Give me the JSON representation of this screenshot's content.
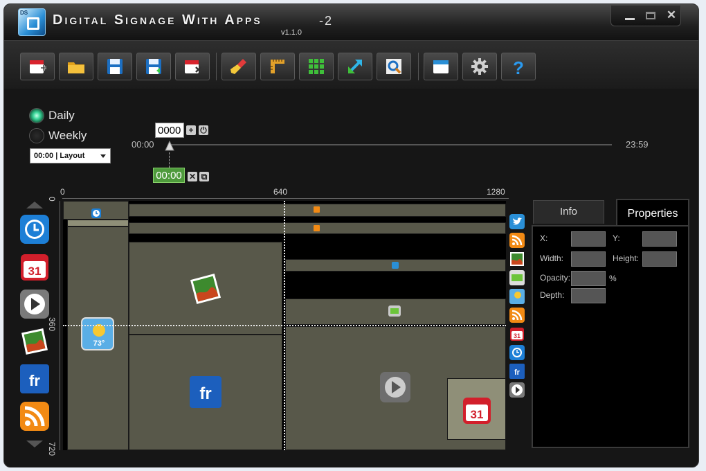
{
  "app": {
    "title": "Digital Signage With Apps",
    "instance": "-2",
    "version": "v1.1.0",
    "logo_text": "DS"
  },
  "window_controls": {
    "minimize": "minimize",
    "maximize": "maximize",
    "close": "✕"
  },
  "toolbar": {
    "buttons": [
      {
        "name": "new-schedule",
        "icon": "calendar-add-icon"
      },
      {
        "name": "open",
        "icon": "folder-icon"
      },
      {
        "name": "save",
        "icon": "floppy-icon"
      },
      {
        "name": "save-as",
        "icon": "floppy-arrow-icon"
      },
      {
        "name": "close-schedule",
        "icon": "calendar-remove-icon"
      },
      {
        "name": "clear",
        "icon": "broom-icon"
      },
      {
        "name": "ruler",
        "icon": "ruler-icon"
      },
      {
        "name": "grid",
        "icon": "grid-icon"
      },
      {
        "name": "resize",
        "icon": "arrows-icon"
      },
      {
        "name": "preview",
        "icon": "magnifier-icon"
      },
      {
        "name": "window",
        "icon": "window-icon"
      },
      {
        "name": "settings",
        "icon": "gear-icon"
      },
      {
        "name": "help",
        "icon": "help-icon"
      }
    ]
  },
  "schedule": {
    "daily_label": "Daily",
    "weekly_label": "Weekly",
    "selected": "Daily",
    "layout_select": "00:00 | Layout",
    "time_input": "0000",
    "current_time": "00:00",
    "start_time": "00:00",
    "end_time": "23:59"
  },
  "ruler": {
    "x_labels": [
      "0",
      "640",
      "1280"
    ],
    "y_labels": [
      "0",
      "360",
      "720"
    ]
  },
  "palette": {
    "left": [
      "clock",
      "calendar",
      "video",
      "picture",
      "flickr",
      "rss"
    ],
    "right": [
      "twitter",
      "rss",
      "picture",
      "text",
      "weather",
      "rss",
      "weather",
      "calendar",
      "clock",
      "flickr",
      "video"
    ]
  },
  "canvas_icons": {
    "calendar_day": "31",
    "weather_temp": "73°",
    "flickr_text": "fr"
  },
  "properties": {
    "tab_info": "Info",
    "tab_properties": "Properties",
    "active_tab": "Properties",
    "x_label": "X:",
    "y_label": "Y:",
    "width_label": "Width:",
    "height_label": "Height:",
    "opacity_label": "Opacity:",
    "opacity_unit": "%",
    "depth_label": "Depth:"
  },
  "colors": {
    "zone": "#58584a",
    "zone_highlight": "#8f8f78",
    "current_time_bg": "#4e9a3c",
    "accent_blue": "#2a8fd6"
  }
}
